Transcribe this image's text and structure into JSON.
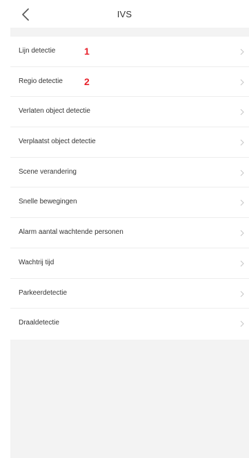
{
  "header": {
    "title": "IVS",
    "back_icon": "chevron-left-icon"
  },
  "menu": {
    "items": [
      {
        "label": "Lijn detectie",
        "marker": "1"
      },
      {
        "label": "Regio detectie",
        "marker": "2"
      },
      {
        "label": "Verlaten object detectie"
      },
      {
        "label": "Verplaatst object detectie"
      },
      {
        "label": "Scene verandering"
      },
      {
        "label": "Snelle bewegingen"
      },
      {
        "label": "Alarm aantal wachtende personen"
      },
      {
        "label": "Wachtrij tijd"
      },
      {
        "label": "Parkeerdetectie"
      },
      {
        "label": "Draaldetectie"
      }
    ],
    "chevron_icon": "chevron-right-icon"
  },
  "colors": {
    "background": "#ffffff",
    "separator_band": "#f3f3f3",
    "text": "#333333",
    "marker": "#e8202a",
    "chevron": "#c8c8c8"
  }
}
